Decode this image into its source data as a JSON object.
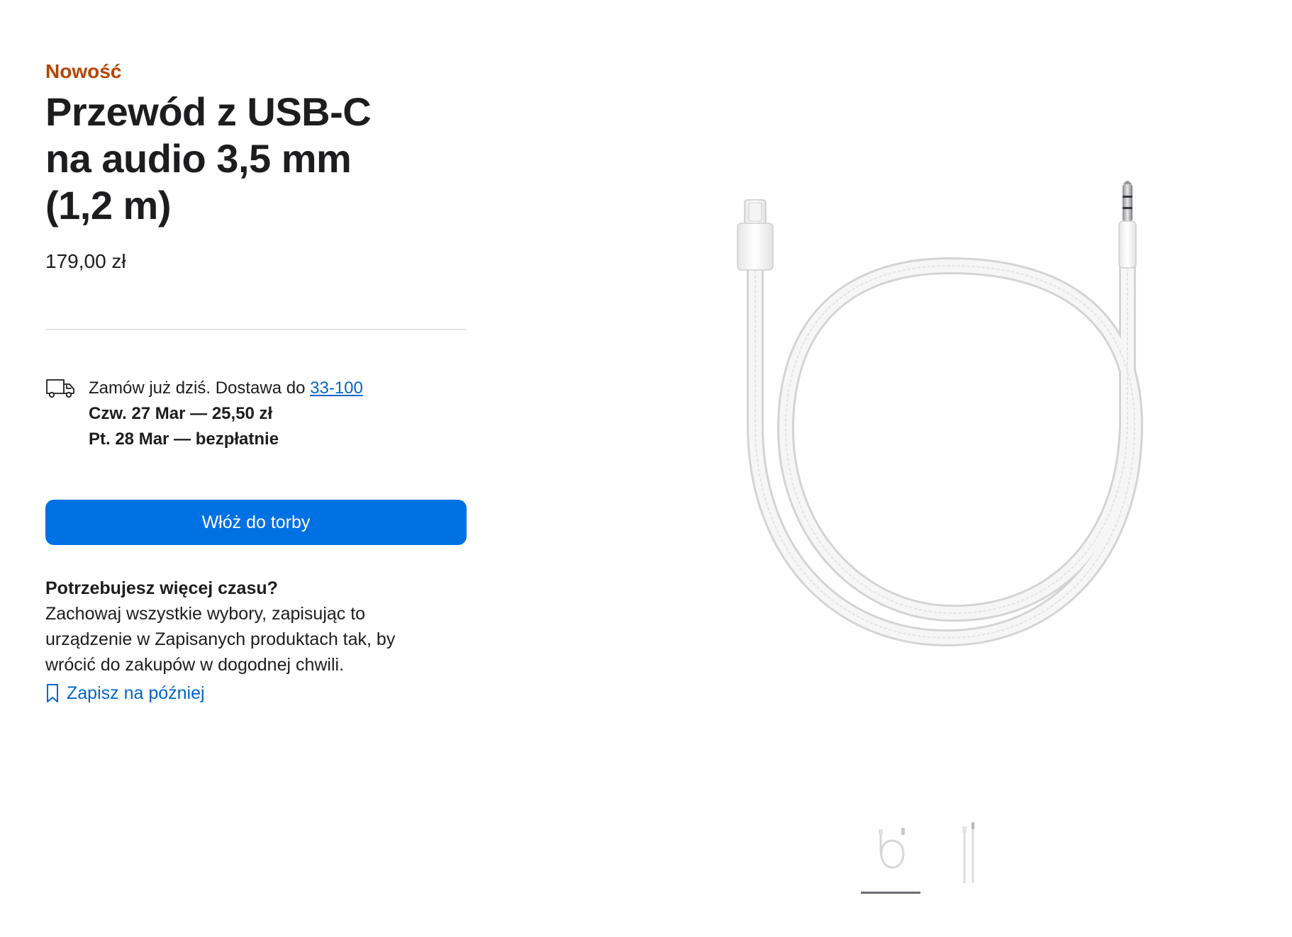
{
  "product": {
    "badge": "Nowość",
    "title_lines": [
      "Przewód z USB-C",
      "na audio 3,5 mm",
      "(1,2 m)"
    ],
    "price": "179,00 zł"
  },
  "delivery": {
    "intro": "Zamów już dziś. Dostawa do ",
    "zip": "33-100",
    "options": [
      "Czw. 27 Mar — 25,50 zł",
      "Pt. 28 Mar — bezpłatnie"
    ],
    "icon": "truck-icon"
  },
  "actions": {
    "add_to_bag": "Włóż do torby",
    "add_to_bag_color": "#0071e3"
  },
  "save": {
    "heading": "Potrzebujesz więcej czasu?",
    "body": "Zachowaj wszystkie wybory, zapisując to urządzenie w Zapisanych produktach tak, by wrócić do zakupów w dogodnej chwili.",
    "link": "Zapisz na później",
    "icon": "bookmark-icon"
  },
  "gallery": {
    "thumbnails": [
      "coiled-cable-thumbnail",
      "straight-cable-thumbnail"
    ],
    "selected": 0
  },
  "colors": {
    "badge": "#b64400",
    "link": "#0066cc"
  }
}
